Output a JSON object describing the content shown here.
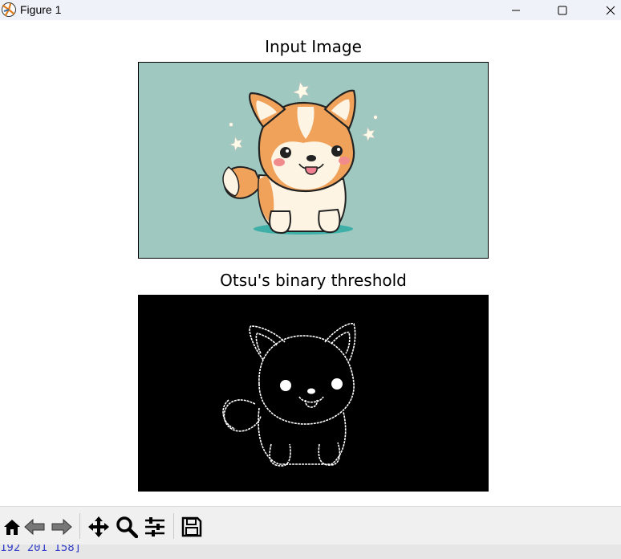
{
  "window": {
    "title": "Figure 1",
    "icon": "matplotlib-icon",
    "controls": [
      "minimize-icon",
      "maximize-icon",
      "close-icon"
    ]
  },
  "figure": {
    "axes": [
      {
        "title": "Input Image",
        "content": "cartoon-corgi-color",
        "background": "#9fc9c0"
      },
      {
        "title": "Otsu's binary threshold",
        "content": "cartoon-corgi-binary-edges",
        "background": "#000000"
      }
    ]
  },
  "toolbar": {
    "buttons": [
      "home-icon",
      "back-icon",
      "forward-icon",
      "pan-icon",
      "zoom-icon",
      "configure-subplots-icon",
      "save-icon"
    ]
  },
  "status": {
    "text": "192 201 158]"
  }
}
